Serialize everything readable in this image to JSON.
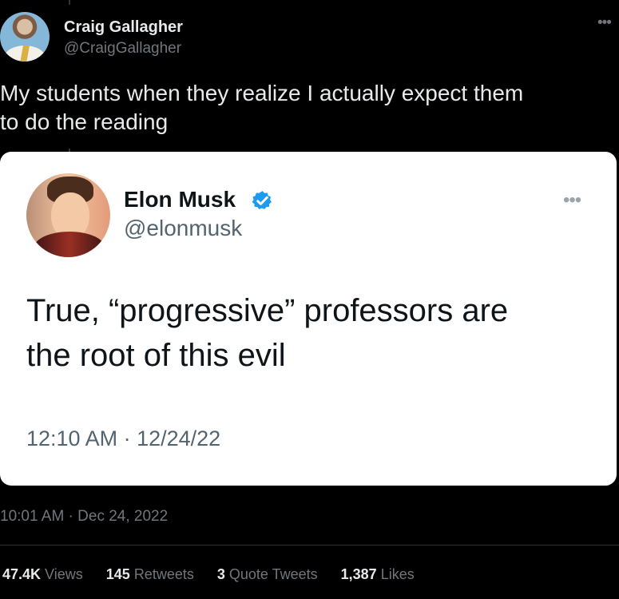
{
  "outer_tweet": {
    "author_name": "Craig Gallagher",
    "handle": "@CraigGallagher",
    "text": "My students when they realize I actually expect them\nto do the reading",
    "timestamp": "10:01 AM · Dec 24, 2022",
    "more_icon": "more-horizontal-icon"
  },
  "quoted_tweet": {
    "author_name": "Elon Musk",
    "verified_icon": "verified-badge-icon",
    "handle": "@elonmusk",
    "text": "True, “progressive” professors are\nthe root of this evil",
    "timestamp": "12:10 AM · 12/24/22",
    "more_icon": "more-horizontal-icon"
  },
  "stats": {
    "views_count": "47.4K",
    "views_label": "Views",
    "retweets_count": "145",
    "retweets_label": "Retweets",
    "quote_count": "3",
    "quote_label": "Quote Tweets",
    "likes_count": "1,387",
    "likes_label": "Likes"
  },
  "colors": {
    "background": "#000000",
    "primary_text": "#e7e9ea",
    "secondary_text": "#71767b",
    "quoted_background": "#ffffff",
    "verified_blue": "#1d9bf0"
  }
}
